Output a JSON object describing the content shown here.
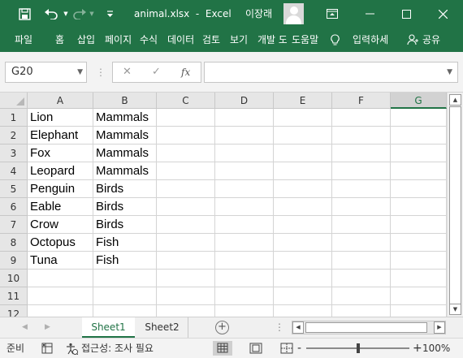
{
  "window": {
    "filename": "animal.xlsx",
    "app_name": "Excel",
    "separator": "-",
    "user_name": "이장래",
    "accent_color": "#217346"
  },
  "ribbon": {
    "tabs": [
      "파일",
      "홈",
      "삽입",
      "페이지",
      "수식",
      "데이터",
      "검토",
      "보기",
      "개발 도",
      "도움말"
    ],
    "tell_me": "입력하세",
    "share": "공유"
  },
  "formula_bar": {
    "name_box": "G20",
    "fx_label": "fx",
    "formula": ""
  },
  "grid": {
    "columns": [
      "A",
      "B",
      "C",
      "D",
      "E",
      "F",
      "G"
    ],
    "selected_column": "G",
    "rows": [
      {
        "num": "1",
        "a": "Lion",
        "b": "Mammals"
      },
      {
        "num": "2",
        "a": "Elephant",
        "b": "Mammals"
      },
      {
        "num": "3",
        "a": "Fox",
        "b": "Mammals"
      },
      {
        "num": "4",
        "a": "Leopard",
        "b": "Mammals"
      },
      {
        "num": "5",
        "a": "Penguin",
        "b": "Birds"
      },
      {
        "num": "6",
        "a": "Eable",
        "b": "Birds"
      },
      {
        "num": "7",
        "a": "Crow",
        "b": "Birds"
      },
      {
        "num": "8",
        "a": "Octopus",
        "b": "Fish"
      },
      {
        "num": "9",
        "a": "Tuna",
        "b": "Fish"
      },
      {
        "num": "10",
        "a": "",
        "b": ""
      },
      {
        "num": "11",
        "a": "",
        "b": ""
      },
      {
        "num": "12",
        "a": "",
        "b": ""
      }
    ]
  },
  "sheets": {
    "tabs": [
      "Sheet1",
      "Sheet2"
    ],
    "active": "Sheet1"
  },
  "status": {
    "ready": "준비",
    "accessibility": "접근성: 조사 필요",
    "zoom_minus": "-",
    "zoom_plus": "+",
    "zoom": "100%"
  }
}
